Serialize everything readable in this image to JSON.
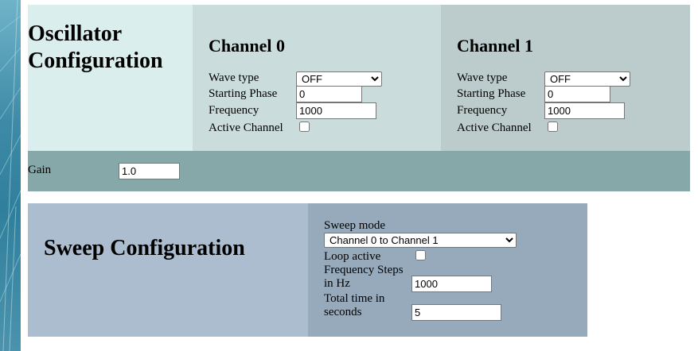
{
  "oscillator": {
    "title": "Oscillator Configuration",
    "channels": [
      {
        "title": "Channel 0",
        "wave_type_label": "Wave type",
        "wave_type_value": "OFF",
        "phase_label": "Starting Phase",
        "phase_value": "0",
        "frequency_label": "Frequency",
        "frequency_value": "1000",
        "active_label": "Active Channel",
        "active_checked": false
      },
      {
        "title": "Channel 1",
        "wave_type_label": "Wave type",
        "wave_type_value": "OFF",
        "phase_label": "Starting Phase",
        "phase_value": "0",
        "frequency_label": "Frequency",
        "frequency_value": "1000",
        "active_label": "Active Channel",
        "active_checked": false
      }
    ],
    "gain_label": "Gain",
    "gain_value": "1.0"
  },
  "sweep": {
    "title": "Sweep Configuration",
    "mode_label": "Sweep mode",
    "mode_value": "Channel 0 to Channel 1",
    "loop_label": "Loop active",
    "loop_checked": false,
    "freq_steps_label_line1": "Frequency Steps",
    "freq_steps_label_line2": "in Hz",
    "freq_steps_value": "1000",
    "total_time_label_line1": "Total time in",
    "total_time_label_line2": "seconds",
    "total_time_value": "5"
  },
  "colors": {
    "osc_title_bg": "#dbeeee",
    "ch0_bg": "#cbdcdc",
    "ch1_bg": "#bccccc",
    "gain_bg": "#86a8a8",
    "sweep_title_bg": "#abbdce",
    "sweep_form_bg": "#97aabb"
  }
}
